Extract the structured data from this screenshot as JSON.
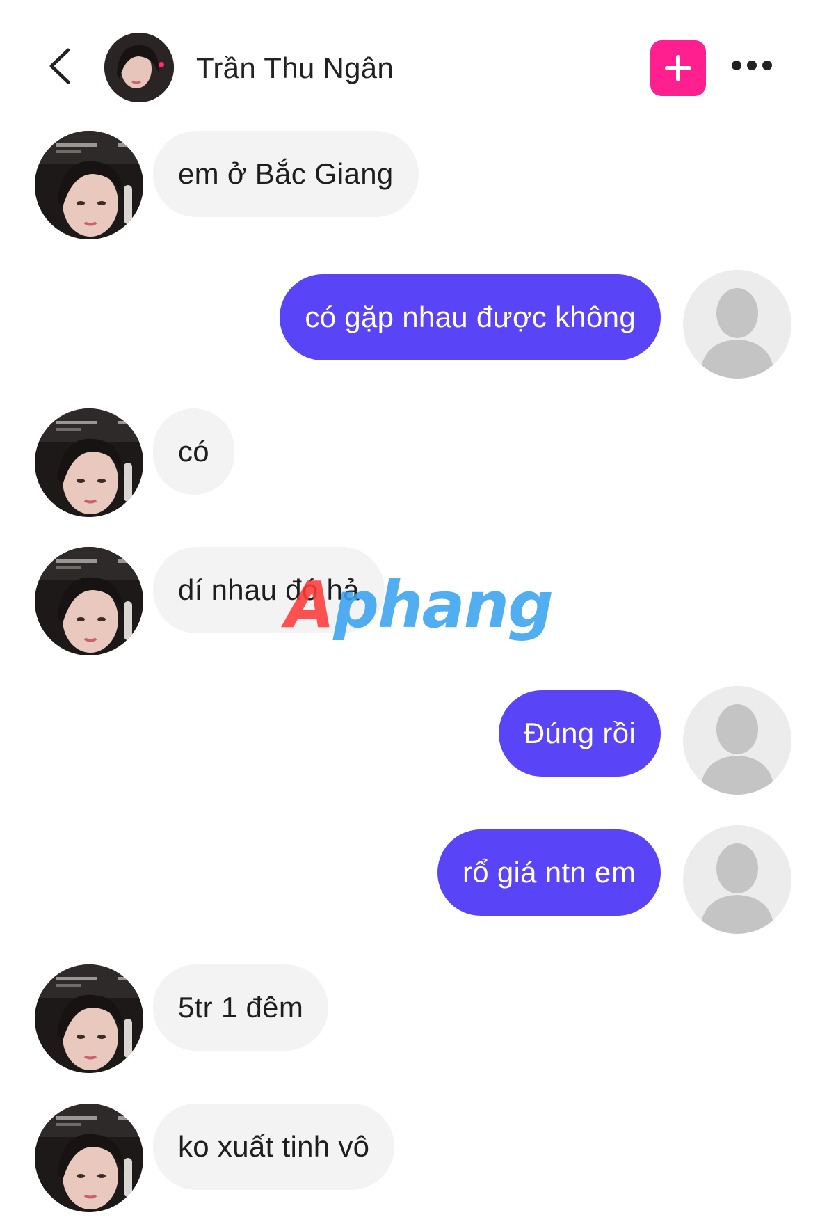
{
  "header": {
    "back_icon": "chevron-left-icon",
    "contact_name": "Trần Thu Ngân",
    "add_icon": "plus-icon",
    "add_color": "#ff1f8e",
    "more_icon": "ellipsis-horizontal-icon"
  },
  "messages": [
    {
      "side": "in",
      "text": "em ở Bắc Giang"
    },
    {
      "side": "out",
      "text": "có gặp nhau được không"
    },
    {
      "side": "in",
      "text": "có"
    },
    {
      "side": "in",
      "text": "dí nhau đó hả"
    },
    {
      "side": "out",
      "text": "Đúng rồi"
    },
    {
      "side": "out",
      "text": "rổ giá ntn em"
    },
    {
      "side": "in",
      "text": "5tr 1 đêm"
    },
    {
      "side": "in",
      "text": "ko xuất tinh vô"
    }
  ],
  "watermark": {
    "part1": "A",
    "part2": "phang"
  },
  "colors": {
    "outgoing_bubble": "#5a44f7",
    "incoming_bubble": "#f3f3f3"
  }
}
